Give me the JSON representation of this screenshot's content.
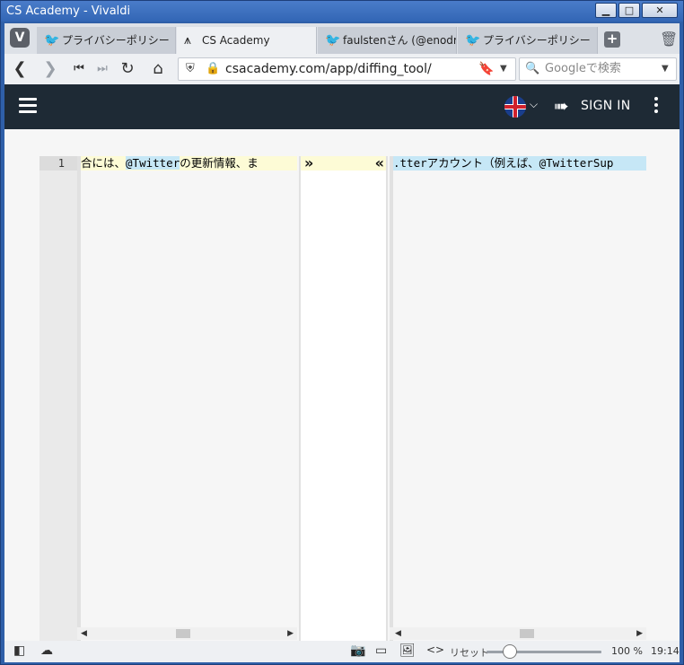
{
  "window": {
    "title": "CS Academy - Vivaldi",
    "controls": [
      "minimize",
      "maximize",
      "close"
    ]
  },
  "tabs": [
    {
      "label": "プライバシーポリシー",
      "icon": "twitter-bird-icon",
      "active": false
    },
    {
      "label": "CS Academy",
      "icon": "csacademy-logo-icon",
      "active": true
    },
    {
      "label": "faulstenさん (@enodrar",
      "icon": "twitter-bird-icon",
      "active": false
    },
    {
      "label": "プライバシーポリシー",
      "icon": "twitter-bird-icon",
      "active": false
    }
  ],
  "navigation": {
    "url": "csacademy.com/app/diffing_tool/",
    "search_placeholder": "Googleで検索"
  },
  "site": {
    "signin_label": "SIGN IN",
    "language_flag": "uk-flag-icon"
  },
  "diff": {
    "line_number": "1",
    "left_text_before": "合には、",
    "left_text_highlight": "@Twitter",
    "left_text_after": "の更新情報、ま",
    "right_text": ".tterアカウント（例えば、@TwitterSup",
    "merge_right": "»",
    "merge_left": "«"
  },
  "statusbar": {
    "reset_label": "リセット",
    "zoom_value": 50,
    "zoom_label": "100 %",
    "clock": "19:14"
  },
  "colors": {
    "site_header": "#1e2a35",
    "added_line": "#fdfbd6",
    "removed_line": "#c6e7f6",
    "window_frame": "#2f5fa8"
  }
}
